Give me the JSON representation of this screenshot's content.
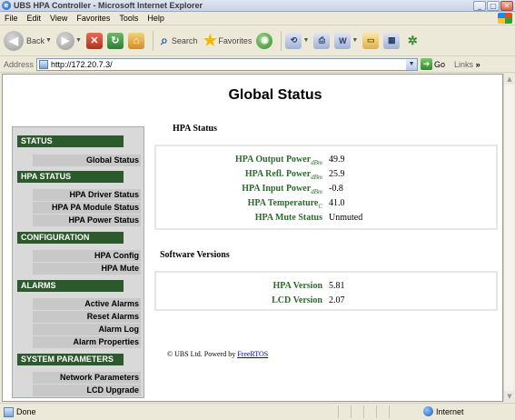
{
  "window": {
    "title": "UBS HPA Controller - Microsoft Internet Explorer"
  },
  "menu": [
    "File",
    "Edit",
    "View",
    "Favorites",
    "Tools",
    "Help"
  ],
  "toolbar": {
    "back_label": "Back",
    "search_label": "Search",
    "favorites_label": "Favorites"
  },
  "address": {
    "label": "Address",
    "url": "http://172.20.7.3/",
    "go_label": "Go",
    "links_label": "Links"
  },
  "page": {
    "title": "Global Status"
  },
  "sidebar": {
    "sections": [
      {
        "header": "STATUS",
        "items": [
          "Global Status"
        ]
      },
      {
        "header": "HPA STATUS",
        "items": [
          "HPA Driver Status",
          "HPA PA Module Status",
          "HPA Power Status"
        ]
      },
      {
        "header": "CONFIGURATION",
        "items": [
          "HPA Config",
          "HPA Mute"
        ]
      },
      {
        "header": "ALARMS",
        "items": [
          "Active Alarms",
          "Reset Alarms",
          "Alarm Log",
          "Alarm Properties"
        ]
      },
      {
        "header": "SYSTEM PARAMETERS",
        "items": [
          "Network Parameters",
          "LCD Upgrade"
        ]
      }
    ]
  },
  "hpa_status": {
    "heading": "HPA Status",
    "rows": [
      {
        "label": "HPA Output Power",
        "unit": "dBm",
        "value": "49.9"
      },
      {
        "label": "HPA Refl. Power",
        "unit": "dBm",
        "value": "25.9"
      },
      {
        "label": "HPA Input Power",
        "unit": "dBm",
        "value": "-0.8"
      },
      {
        "label": "HPA Temperature",
        "unit": "C",
        "value": "41.0"
      },
      {
        "label": "HPA Mute Status",
        "unit": "",
        "value": "Unmuted"
      }
    ]
  },
  "software_versions": {
    "heading": "Software Versions",
    "rows": [
      {
        "label": "HPA Version",
        "value": "5.81"
      },
      {
        "label": "LCD Version",
        "value": "2.07"
      }
    ]
  },
  "footer": {
    "text": "© UBS Ltd. Powerd by ",
    "link": "FreeRTOS"
  },
  "status": {
    "text": "Done",
    "zone": "Internet"
  }
}
